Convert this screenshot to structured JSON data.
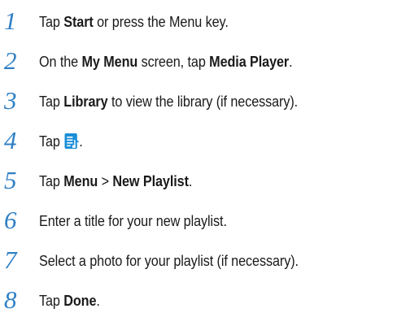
{
  "steps": [
    {
      "num": "1",
      "a": "Tap ",
      "b": "Start",
      "c": " or press the Menu key."
    },
    {
      "num": "2",
      "a": "On the ",
      "b": "My Menu",
      "c": " screen, tap ",
      "d": "Media Player",
      "e": "."
    },
    {
      "num": "3",
      "a": "Tap ",
      "b": "Library",
      "c": " to view the library (if necessary)."
    },
    {
      "num": "4",
      "a": "Tap",
      "icon": "playlist-icon",
      "c": "."
    },
    {
      "num": "5",
      "a": "Tap ",
      "b": "Menu",
      "c": " > ",
      "d": "New Playlist",
      "e": "."
    },
    {
      "num": "6",
      "a": "Enter a title for your new playlist."
    },
    {
      "num": "7",
      "a": "Select a photo for your playlist (if necessary)."
    },
    {
      "num": "8",
      "a": "Tap ",
      "b": "Done",
      "c": "."
    }
  ],
  "colors": {
    "step_number": "#2f7fc4",
    "icon_bg": "#1a8fd8",
    "icon_fg": "#ffffff"
  }
}
